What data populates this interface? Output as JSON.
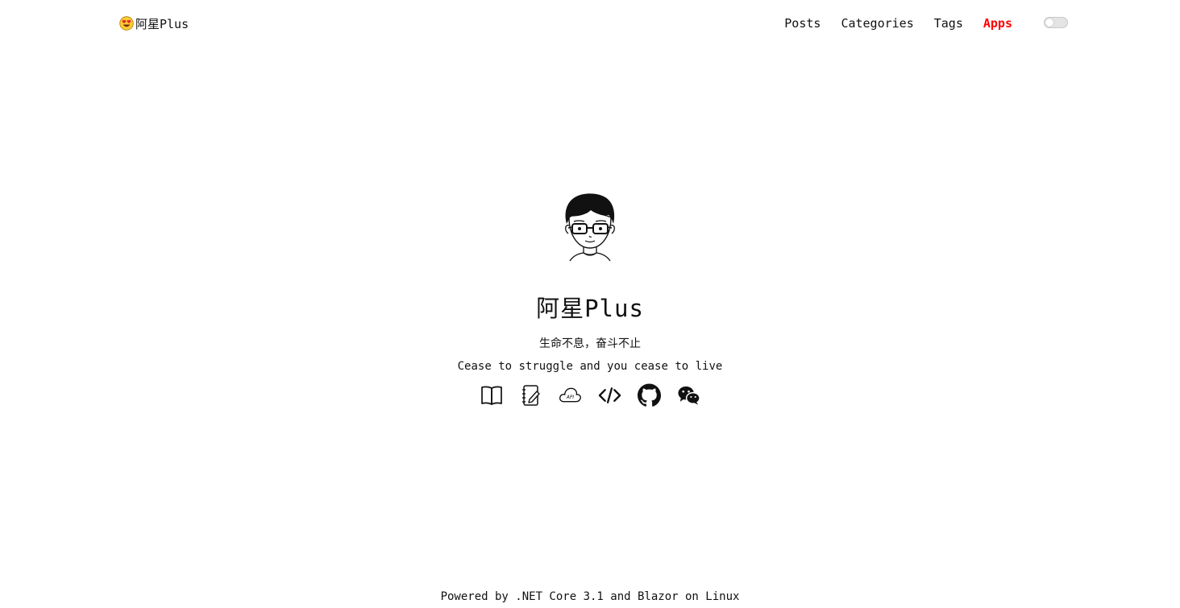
{
  "header": {
    "logo_text": "阿星Plus",
    "logo_icon": "smiling-face-with-heart-eyes-emoji",
    "nav": [
      {
        "label": "Posts",
        "active": false
      },
      {
        "label": "Categories",
        "active": false
      },
      {
        "label": "Tags",
        "active": false
      },
      {
        "label": "Apps",
        "active": true
      }
    ],
    "theme_toggle_on": false
  },
  "hero": {
    "title": "阿星Plus",
    "motto_cn": "生命不息，奋斗不止",
    "motto_en": "Cease to struggle and you cease to live",
    "links": [
      {
        "icon": "book-icon"
      },
      {
        "icon": "notebook-icon"
      },
      {
        "icon": "cloud-api-icon"
      },
      {
        "icon": "code-icon"
      },
      {
        "icon": "github-icon"
      },
      {
        "icon": "wechat-icon"
      }
    ]
  },
  "footer": {
    "text": "Powered by .NET Core 3.1 and Blazor on Linux"
  },
  "colors": {
    "accent": "#ff0000",
    "text": "#111111",
    "background": "#ffffff"
  }
}
